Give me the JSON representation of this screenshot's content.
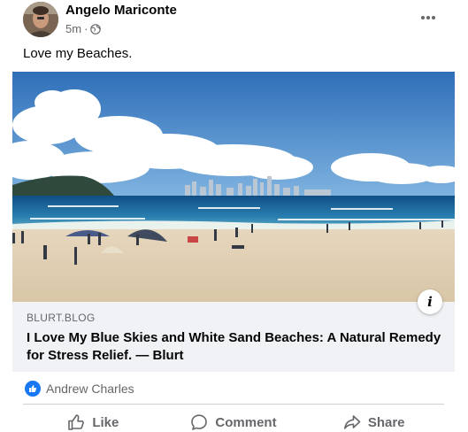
{
  "post": {
    "author": "Angelo Mariconte",
    "timestamp": "5m",
    "separator": "·",
    "privacy_icon": "globe-icon",
    "more_icon": "more-horizontal-icon",
    "caption": "Love my Beaches."
  },
  "link_preview": {
    "domain": "BLURT.BLOG",
    "title": "I Love My Blue Skies and White Sand Beaches: A Natural Remedy for Stress Relief. — Blurt",
    "info_label": "i"
  },
  "reactions": {
    "icon": "like-icon",
    "reactor_name": "Andrew Charles"
  },
  "actions": [
    {
      "label": "Like",
      "icon": "thumbs-up-icon"
    },
    {
      "label": "Comment",
      "icon": "comment-icon"
    },
    {
      "label": "Share",
      "icon": "share-icon"
    }
  ],
  "colors": {
    "accent": "#1877f2",
    "secondary_text": "#65676b",
    "card_bg": "#f0f2f5"
  }
}
